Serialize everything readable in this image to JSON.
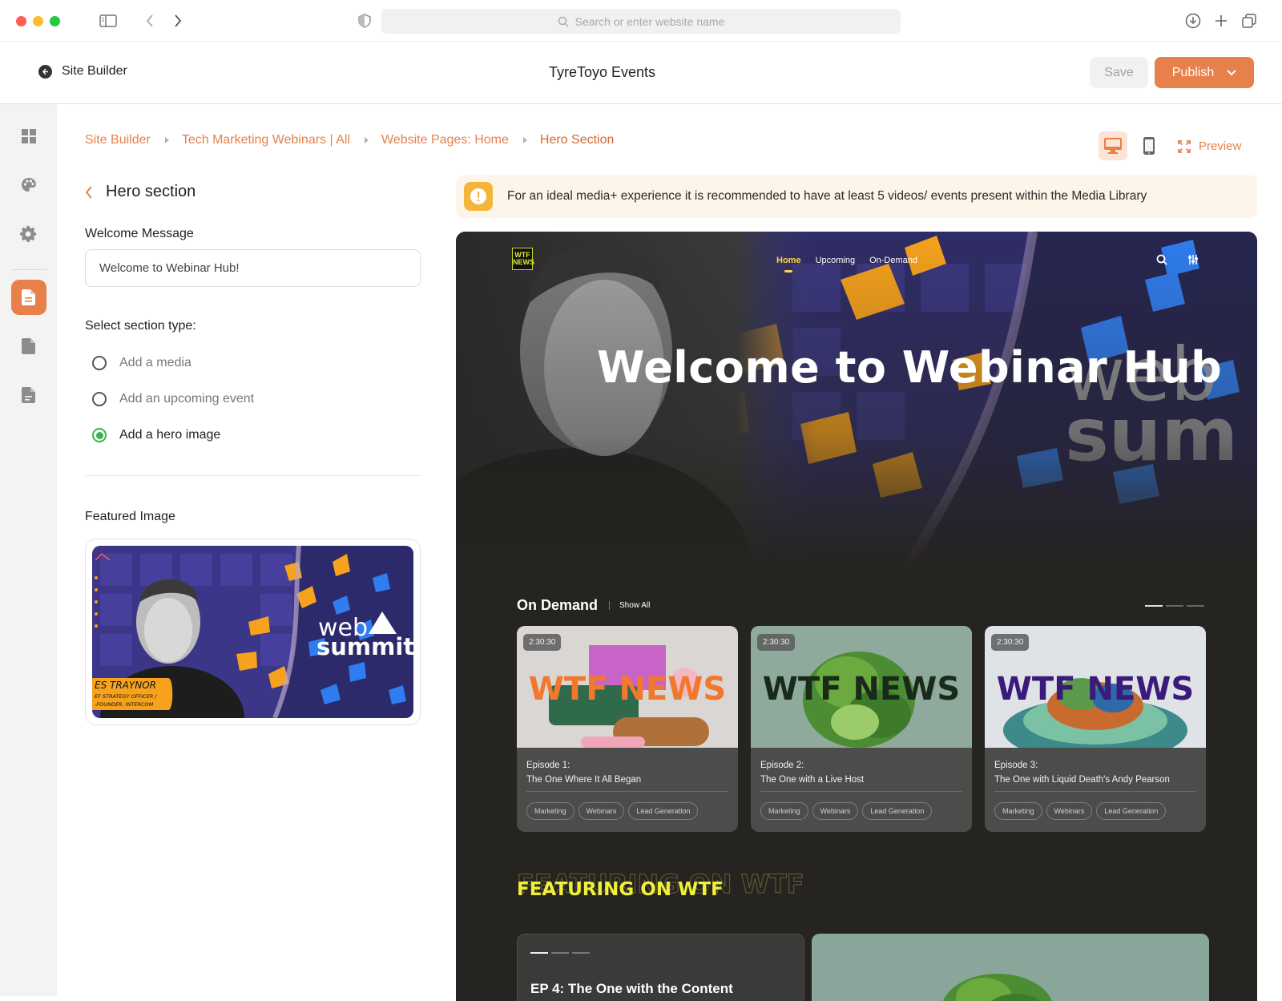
{
  "browser": {
    "url_placeholder": "Search or enter website name"
  },
  "app": {
    "back_label": "Site Builder",
    "event_title": "TyreToyo Events",
    "save_label": "Save",
    "publish_label": "Publish"
  },
  "breadcrumb": [
    "Site Builder",
    "Tech Marketing Webinars | All",
    "Website Pages: Home",
    "Hero Section"
  ],
  "toolbar": {
    "preview_label": "Preview"
  },
  "panel": {
    "title": "Hero section",
    "welcome_label": "Welcome Message",
    "welcome_value": "Welcome to Webinar Hub!",
    "section_type_label": "Select section type:",
    "options": [
      {
        "label": "Add a media",
        "selected": false
      },
      {
        "label": "Add an upcoming event",
        "selected": false
      },
      {
        "label": "Add a hero image",
        "selected": true
      }
    ],
    "featured_label": "Featured Image",
    "featured_image_text": {
      "caption_name": "ES TRAYNOR",
      "caption_role": "EF STRATEGY OFFICER / -FOUNDER, INTERCOM",
      "brand_top": "web",
      "brand_bottom": "summit"
    }
  },
  "warning": {
    "text": "For an ideal media+ experience it is recommended to have at least 5 videos/ events present within the Media Library"
  },
  "preview": {
    "logo_text": "WTF NEWS",
    "nav": [
      "Home",
      "Upcoming",
      "On-Demand"
    ],
    "hero_title": "Welcome to Webinar Hub",
    "hero_brand_top": "web",
    "hero_brand_bottom": "sum",
    "on_demand_title": "On Demand",
    "show_all": "Show All",
    "cards": [
      {
        "duration": "2:30:30",
        "thumb_text": "WTF NEWS",
        "episode": "Episode 1:",
        "title": "The One Where It All Began",
        "tags": [
          "Marketing",
          "Webinars",
          "Lead Generation"
        ]
      },
      {
        "duration": "2:30:30",
        "thumb_text": "WTF NEWS",
        "episode": "Episode 2:",
        "title": "The One with a Live Host",
        "tags": [
          "Marketing",
          "Webinars",
          "Lead Generation"
        ]
      },
      {
        "duration": "2:30:30",
        "thumb_text": "WTF NEWS",
        "episode": "Episode 3:",
        "title": "The One with Liquid Death's Andy Pearson",
        "tags": [
          "Marketing",
          "Webinars",
          "Lead Generation"
        ]
      }
    ],
    "featuring_title": "FEATURING ON WTF",
    "ep4_title": "EP 4: The One with the Content"
  },
  "colors": {
    "accent": "#e7804b",
    "success": "#36b44a",
    "warning": "#f4b53b",
    "highlight": "#f0f03a"
  }
}
